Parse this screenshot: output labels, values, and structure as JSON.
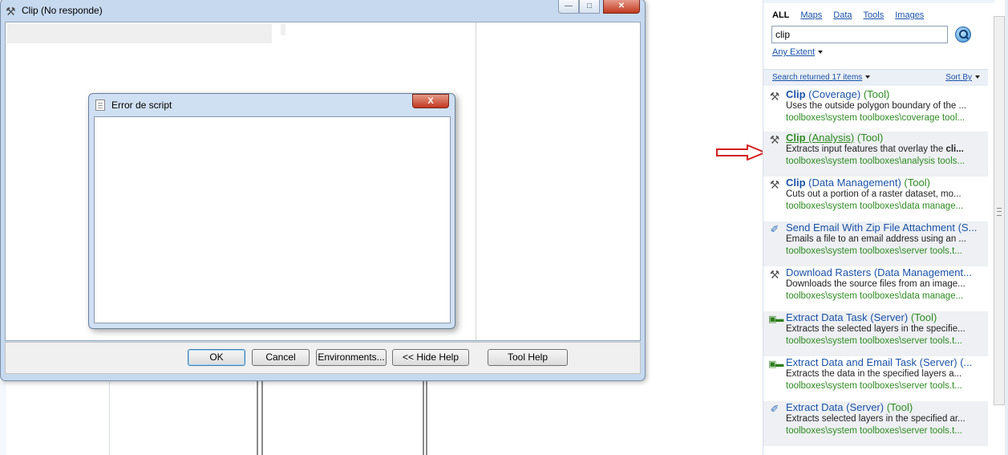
{
  "clip_window": {
    "title": "Clip (No responde)",
    "buttons": {
      "ok": "OK",
      "cancel": "Cancel",
      "environments": "Environments...",
      "hide_help": "<< Hide Help",
      "tool_help": "Tool Help"
    }
  },
  "error_dialog": {
    "title": "Error de script",
    "close": "X",
    "text": ""
  },
  "search": {
    "tabs": [
      "ALL",
      "Maps",
      "Data",
      "Tools",
      "Images"
    ],
    "active_tab": "ALL",
    "query": "clip",
    "extent": "Any Extent",
    "results_count": "Search returned 17 items",
    "sort_by": "Sort By",
    "results": [
      {
        "icon": "hammer-icon",
        "name": "Clip",
        "rest": " (Coverage)",
        "type": " (Tool)",
        "desc_pre": "Uses the outside polygon boundary of the ...",
        "desc_bold": "",
        "path": "toolboxes\\system toolboxes\\coverage tool..."
      },
      {
        "icon": "hammer-icon",
        "name": "Clip",
        "rest": " (Analysis)",
        "type": " (Tool)",
        "desc_pre": "Extracts input features that overlay the ",
        "desc_bold": "cli...",
        "path": "toolboxes\\system toolboxes\\analysis tools..."
      },
      {
        "icon": "hammer-icon",
        "name": "Clip",
        "rest": " (Data Management)",
        "type": " (Tool)",
        "desc_pre": "Cuts out a portion of a raster dataset, mo...",
        "desc_bold": "",
        "path": "toolboxes\\system toolboxes\\data manage..."
      },
      {
        "icon": "script-icon",
        "name": "",
        "rest": "Send Email With Zip File Attachment (S...",
        "type": "",
        "desc_pre": "Emails a file to an email address using an ...",
        "desc_bold": "",
        "path": "toolboxes\\system toolboxes\\server tools.t..."
      },
      {
        "icon": "hammer-icon",
        "name": "",
        "rest": "Download Rasters (Data Management...",
        "type": "",
        "desc_pre": "Downloads the source files from an image...",
        "desc_bold": "",
        "path": "toolboxes\\system toolboxes\\data manage..."
      },
      {
        "icon": "model-icon",
        "name": "",
        "rest": "Extract Data Task (Server)",
        "type": " (Tool)",
        "desc_pre": "Extracts the selected layers in the specifie...",
        "desc_bold": "",
        "path": "toolboxes\\system toolboxes\\server tools.t..."
      },
      {
        "icon": "model-icon",
        "name": "",
        "rest": "Extract Data and Email Task (Server) (...",
        "type": "",
        "desc_pre": "Extracts the data in the specified layers a...",
        "desc_bold": "",
        "path": "toolboxes\\system toolboxes\\server tools.t..."
      },
      {
        "icon": "script-icon",
        "name": "",
        "rest": "Extract Data (Server)",
        "type": " (Tool)",
        "desc_pre": "Extracts selected layers in the specified ar...",
        "desc_bold": "",
        "path": "toolboxes\\system toolboxes\\server tools.t..."
      }
    ]
  },
  "colors": {
    "link_blue": "#1a52a8",
    "path_green": "#2e8b22",
    "arrow_red": "#d81e1e",
    "window_frame": "#c6d9ef"
  }
}
